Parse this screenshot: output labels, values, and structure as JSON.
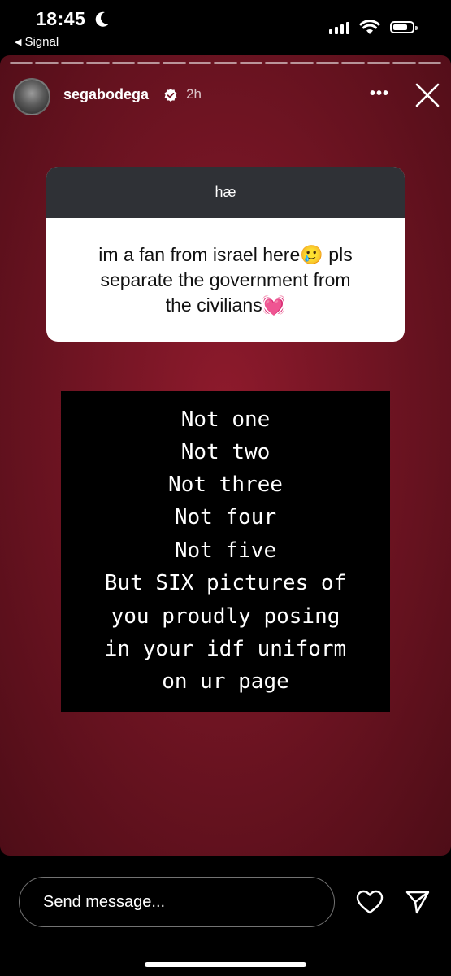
{
  "status_bar": {
    "time": "18:45",
    "back_app": "Signal",
    "icons": [
      "moon-icon",
      "cellular-signal-icon",
      "wifi-icon",
      "battery-icon"
    ]
  },
  "story": {
    "progress_segments": 17,
    "username": "segabodega",
    "verified": true,
    "time_ago": "2h",
    "more_label": "•••",
    "background_color": "#741524"
  },
  "question_card": {
    "header": "hæ",
    "question_lines": [
      "im a fan from israel here🥲 pls",
      "separate the government from",
      "the civilians💓"
    ]
  },
  "quote_box": {
    "lines": [
      "Not one",
      "Not two",
      "Not three",
      "Not four",
      "Not five",
      "But SIX pictures of",
      "you proudly posing",
      "in your idf uniform",
      "on ur page"
    ]
  },
  "footer": {
    "send_placeholder": "Send message..."
  }
}
